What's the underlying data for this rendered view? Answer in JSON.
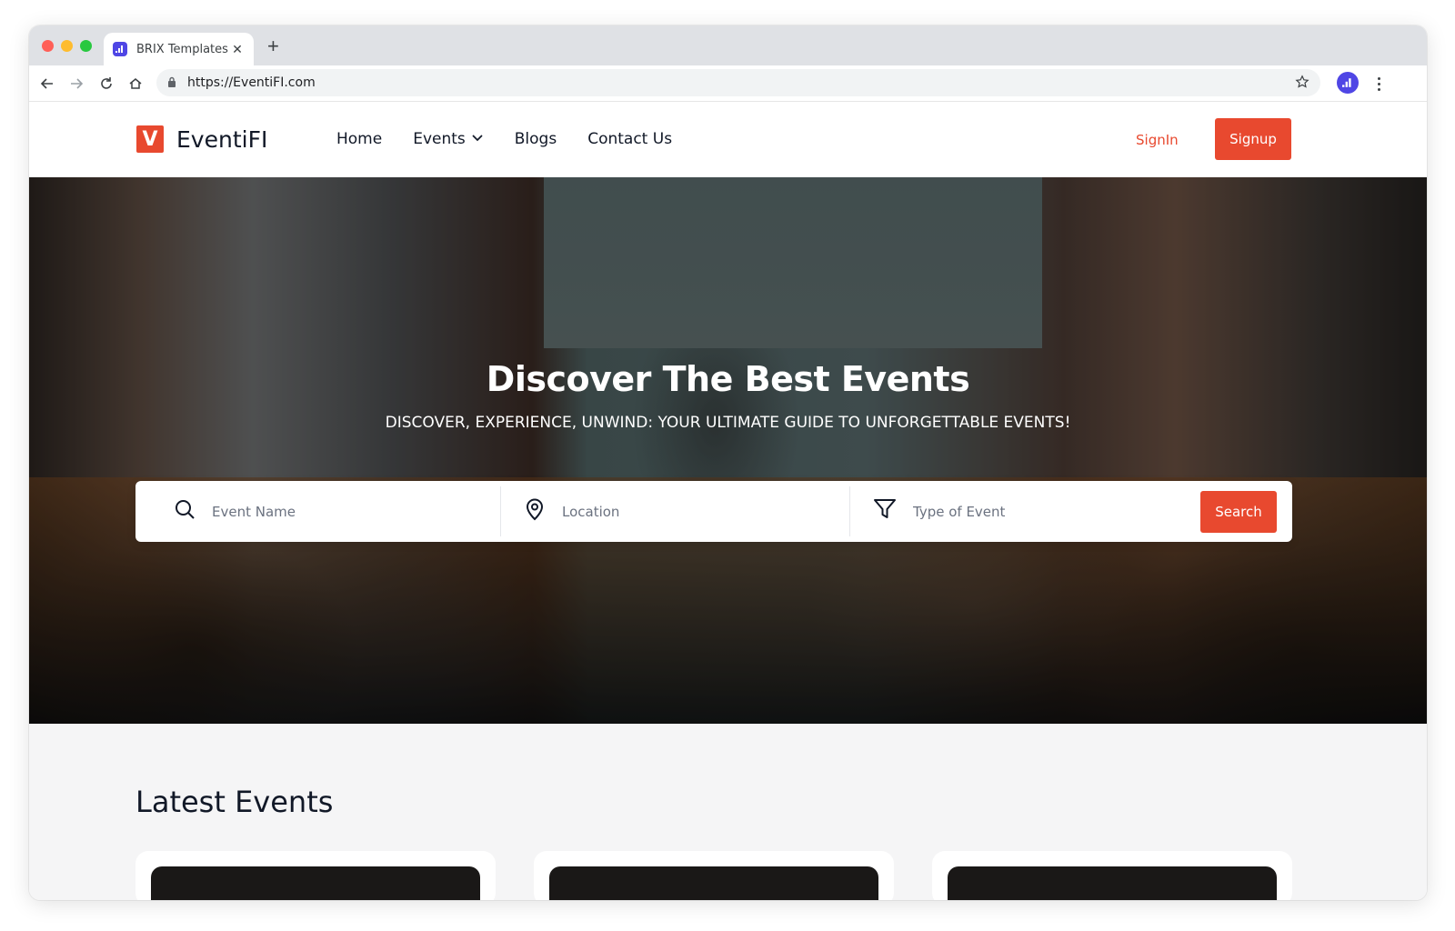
{
  "browser": {
    "tab_title": "BRIX Templates",
    "url": "https://EventiFI.com"
  },
  "site": {
    "logo_letter": "V",
    "brand": "EventiFI",
    "nav": [
      {
        "label": "Home"
      },
      {
        "label": "Events"
      },
      {
        "label": "Blogs"
      },
      {
        "label": "Contact Us"
      }
    ],
    "signin_label": "SignIn",
    "signup_label": "Signup"
  },
  "hero": {
    "title": "Discover The Best Events",
    "subtitle": "DISCOVER, EXPERIENCE, UNWIND: YOUR ULTIMATE GUIDE TO UNFORGETTABLE EVENTS!",
    "search": {
      "event_name_placeholder": "Event Name",
      "location_placeholder": "Location",
      "type_placeholder": "Type of Event",
      "button_label": "Search"
    }
  },
  "latest": {
    "title": "Latest Events"
  },
  "colors": {
    "accent": "#e8492f",
    "brand_purple": "#4f46e5",
    "section_bg": "#f5f5f6"
  }
}
